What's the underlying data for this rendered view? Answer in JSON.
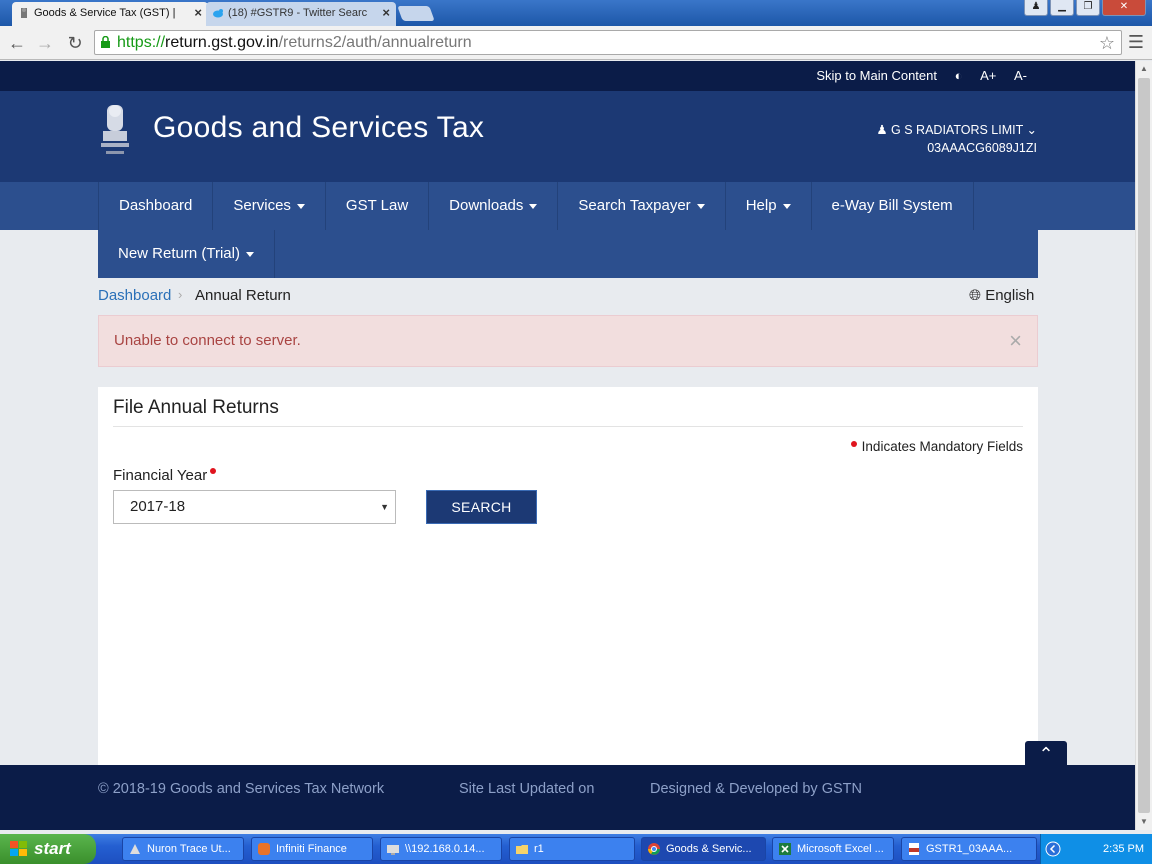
{
  "browser": {
    "tabs": [
      {
        "title": "Goods & Service Tax (GST) |",
        "active": true
      },
      {
        "title": "(18) #GSTR9 - Twitter Searc",
        "active": false
      }
    ],
    "url_scheme": "https://",
    "url_host": "return.gst.gov.in",
    "url_path": "/returns2/auth/annualreturn"
  },
  "topstrip": {
    "skip": "Skip to Main Content",
    "contrast_icon": "contrast-icon",
    "font_increase": "A+",
    "font_decrease": "A-"
  },
  "header": {
    "title": "Goods and Services Tax",
    "user_name": "G S RADIATORS LIMIT",
    "gstin": "03AAACG6089J1ZI"
  },
  "nav": {
    "items": [
      {
        "label": "Dashboard",
        "dropdown": false
      },
      {
        "label": "Services",
        "dropdown": true
      },
      {
        "label": "GST Law",
        "dropdown": false
      },
      {
        "label": "Downloads",
        "dropdown": true
      },
      {
        "label": "Search Taxpayer",
        "dropdown": true
      },
      {
        "label": "Help",
        "dropdown": true
      },
      {
        "label": "e-Way Bill System",
        "dropdown": false
      }
    ],
    "second_row": {
      "label": "New Return (Trial)",
      "dropdown": true
    }
  },
  "breadcrumb": {
    "home": "Dashboard",
    "separator": "›",
    "current": "Annual Return",
    "language": "English"
  },
  "alert": {
    "message": "Unable to connect to server.",
    "close": "×"
  },
  "panel": {
    "title": "File Annual Returns",
    "mandatory_note": "Indicates Mandatory Fields",
    "financial_year_label": "Financial Year",
    "financial_year_value": "2017-18",
    "search_button": "SEARCH"
  },
  "footer": {
    "copyright": "© 2018-19 Goods and Services Tax Network",
    "updated": "Site Last Updated on",
    "designed": "Designed & Developed by GSTN"
  },
  "taskbar": {
    "start": "start",
    "tasks": [
      {
        "label": "Nuron Trace Ut...",
        "active": false
      },
      {
        "label": "Infiniti Finance",
        "active": false
      },
      {
        "label": "\\\\192.168.0.14...",
        "active": false
      },
      {
        "label": "r1",
        "active": false
      },
      {
        "label": "Goods & Servic...",
        "active": true
      },
      {
        "label": "Microsoft Excel ...",
        "active": false
      },
      {
        "label": "GSTR1_03AAA...",
        "active": false
      }
    ],
    "clock": "2:35 PM"
  },
  "colors": {
    "header_bg": "#1c3974",
    "topstrip_bg": "#0b1c48",
    "nav_bg": "#2c4f8e",
    "alert_bg": "#f2dede",
    "alert_text": "#a94442",
    "link": "#2a70b8",
    "mandatory_dot": "#e0141e"
  }
}
